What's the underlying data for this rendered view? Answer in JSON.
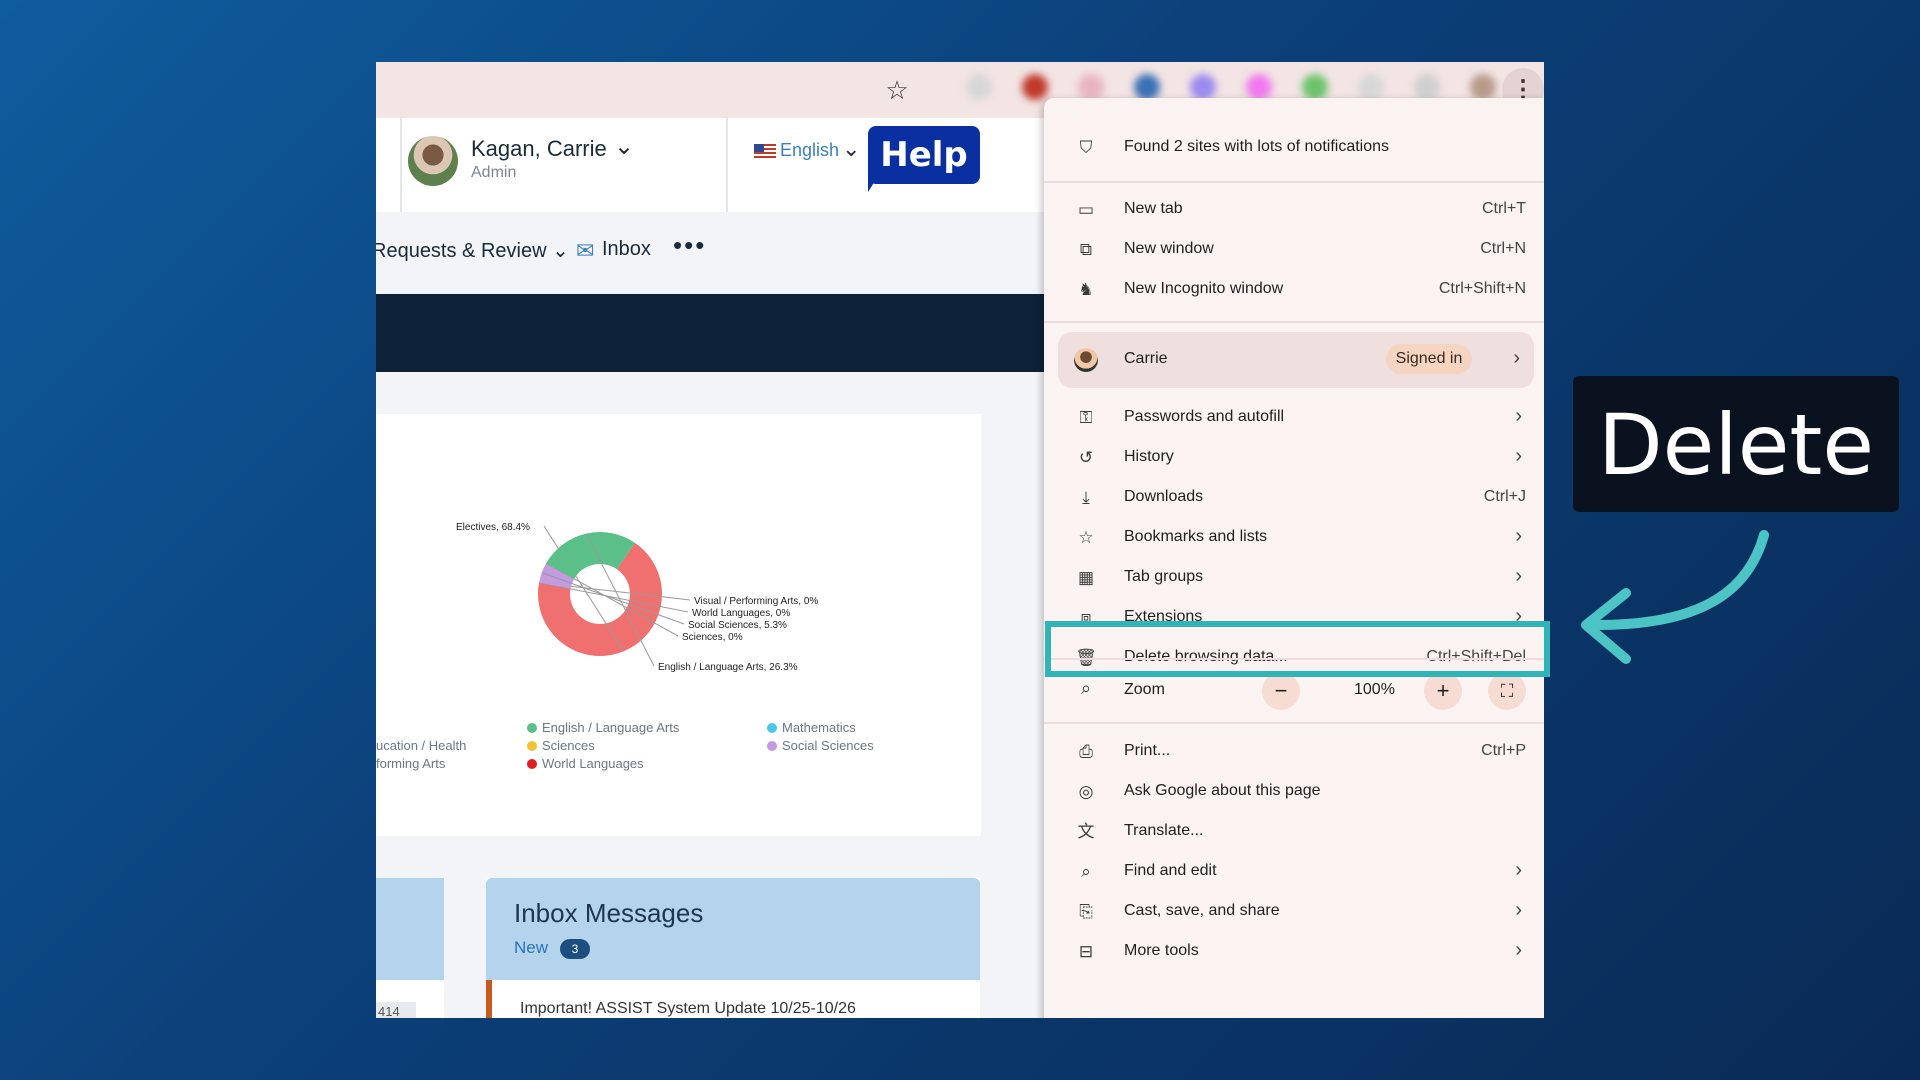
{
  "overlay": {
    "caption": "Delete"
  },
  "browser": {
    "toolbar_extensions": [
      "#d7d7d7",
      "#c0392b",
      "#e8b4c0",
      "#3a6fb5",
      "#9b8af0",
      "#f07af0",
      "#6cc36c",
      "#d7d7d7",
      "#cfcfcf",
      "#b89a8a"
    ]
  },
  "page": {
    "user": {
      "name": "Kagan, Carrie",
      "role": "Admin"
    },
    "language": "English",
    "help_label": "Help",
    "nav": {
      "requests": "Requests & Review",
      "inbox": "Inbox",
      "more": "•••"
    },
    "inbox_card": {
      "title": "Inbox Messages",
      "new_label": "New",
      "new_count": "3",
      "first_message": "Important! ASSIST System Update 10/25-10/26"
    },
    "left_card_number": "414"
  },
  "chart_data": {
    "type": "pie",
    "donut": true,
    "categories": [
      "Electives",
      "Visual / Performing Arts",
      "World Languages",
      "Social Sciences",
      "Sciences",
      "English / Language Arts"
    ],
    "values": [
      68.4,
      0,
      0,
      5.3,
      0,
      26.3
    ],
    "slice_labels": [
      "Electives, 68.4%",
      "Visual / Performing Arts, 0%",
      "World Languages, 0%",
      "Social Sciences, 5.3%",
      "Sciences, 0%",
      "English / Language Arts, 26.3%"
    ],
    "colors": [
      "#f07070",
      "#9ad0e0",
      "#e02020",
      "#c49ae0",
      "#f2c230",
      "#5bbf8a"
    ],
    "legend": [
      {
        "label": "English / Language Arts",
        "color": "#5bbf8a"
      },
      {
        "label": "Mathematics",
        "color": "#4ac8e8"
      },
      {
        "label": "ucation / Health",
        "color": ""
      },
      {
        "label": "Sciences",
        "color": "#f2c230"
      },
      {
        "label": "Social Sciences",
        "color": "#c49ae0"
      },
      {
        "label": "forming Arts",
        "color": ""
      },
      {
        "label": "World Languages",
        "color": "#e02020"
      }
    ]
  },
  "menu": {
    "notification": "Found 2 sites with lots of notifications",
    "items_top": [
      {
        "label": "New tab",
        "shortcut": "Ctrl+T",
        "icon": "new-tab-icon"
      },
      {
        "label": "New window",
        "shortcut": "Ctrl+N",
        "icon": "new-window-icon"
      },
      {
        "label": "New Incognito window",
        "shortcut": "Ctrl+Shift+N",
        "icon": "incognito-icon"
      }
    ],
    "profile": {
      "name": "Carrie",
      "status": "Signed in"
    },
    "items_mid": [
      {
        "label": "Passwords and autofill",
        "shortcut": "",
        "icon": "key-icon"
      },
      {
        "label": "History",
        "shortcut": "",
        "icon": "history-icon"
      },
      {
        "label": "Downloads",
        "shortcut": "Ctrl+J",
        "icon": "download-icon"
      },
      {
        "label": "Bookmarks and lists",
        "shortcut": "",
        "icon": "star-icon"
      },
      {
        "label": "Tab groups",
        "shortcut": "",
        "icon": "tab-groups-icon"
      },
      {
        "label": "Extensions",
        "shortcut": "",
        "icon": "puzzle-icon"
      },
      {
        "label": "Delete browsing data...",
        "shortcut": "Ctrl+Shift+Del",
        "icon": "trash-icon"
      }
    ],
    "zoom": {
      "label": "Zoom",
      "value": "100%"
    },
    "items_bottom": [
      {
        "label": "Print...",
        "shortcut": "Ctrl+P",
        "icon": "printer-icon"
      },
      {
        "label": "Ask Google about this page",
        "shortcut": "",
        "icon": "lens-icon"
      },
      {
        "label": "Translate...",
        "shortcut": "",
        "icon": "translate-icon"
      },
      {
        "label": "Find and edit",
        "shortcut": "",
        "icon": "find-icon"
      },
      {
        "label": "Cast, save, and share",
        "shortcut": "",
        "icon": "cast-icon"
      },
      {
        "label": "More tools",
        "shortcut": "",
        "icon": "toolbox-icon"
      }
    ]
  }
}
